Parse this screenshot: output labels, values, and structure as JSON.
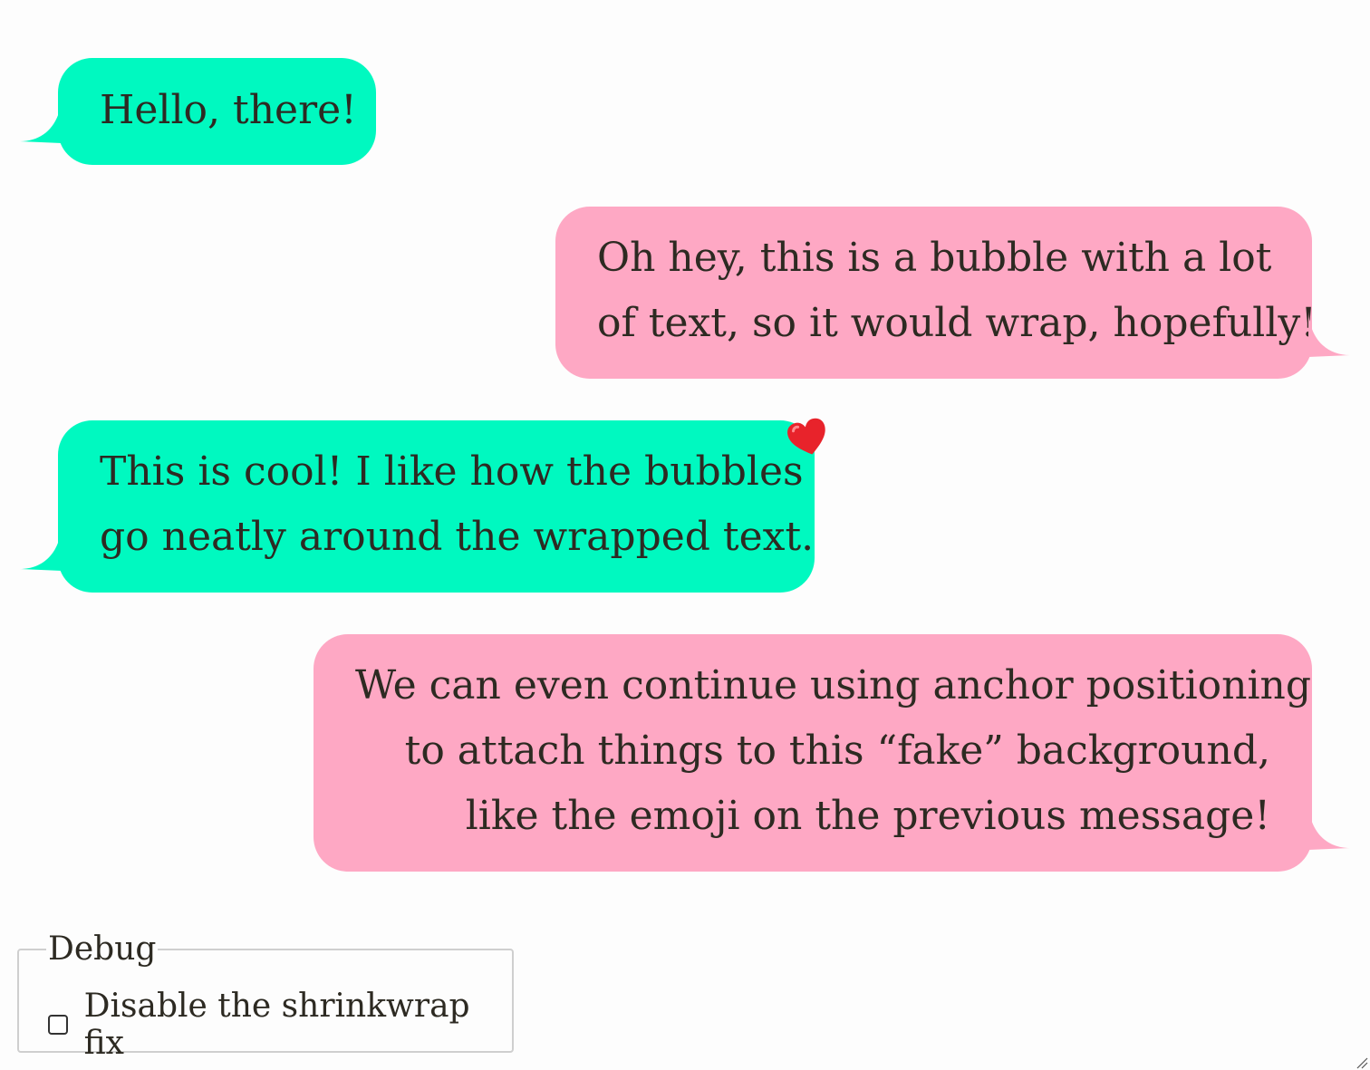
{
  "colors": {
    "left_bubble": "#00f9c0",
    "right_bubble": "#fea8c4",
    "text": "#2d2a22"
  },
  "messages": [
    {
      "side": "left",
      "lines": [
        "Hello, there!"
      ]
    },
    {
      "side": "right",
      "lines": [
        "Oh hey, this is a bubble with a lot",
        "of text, so it would wrap, hopefully!"
      ]
    },
    {
      "side": "left",
      "lines": [
        "This is cool! I like how the bubbles",
        "go neatly around the wrapped text."
      ],
      "reaction": "heart-emoji"
    },
    {
      "side": "right",
      "lines": [
        "We can even continue using anchor positioning",
        "to attach things to this “fake” background,",
        "like the emoji on the previous message!"
      ]
    }
  ],
  "debug": {
    "legend": "Debug",
    "checkbox_label": "Disable the shrinkwrap fix",
    "checked": false
  }
}
